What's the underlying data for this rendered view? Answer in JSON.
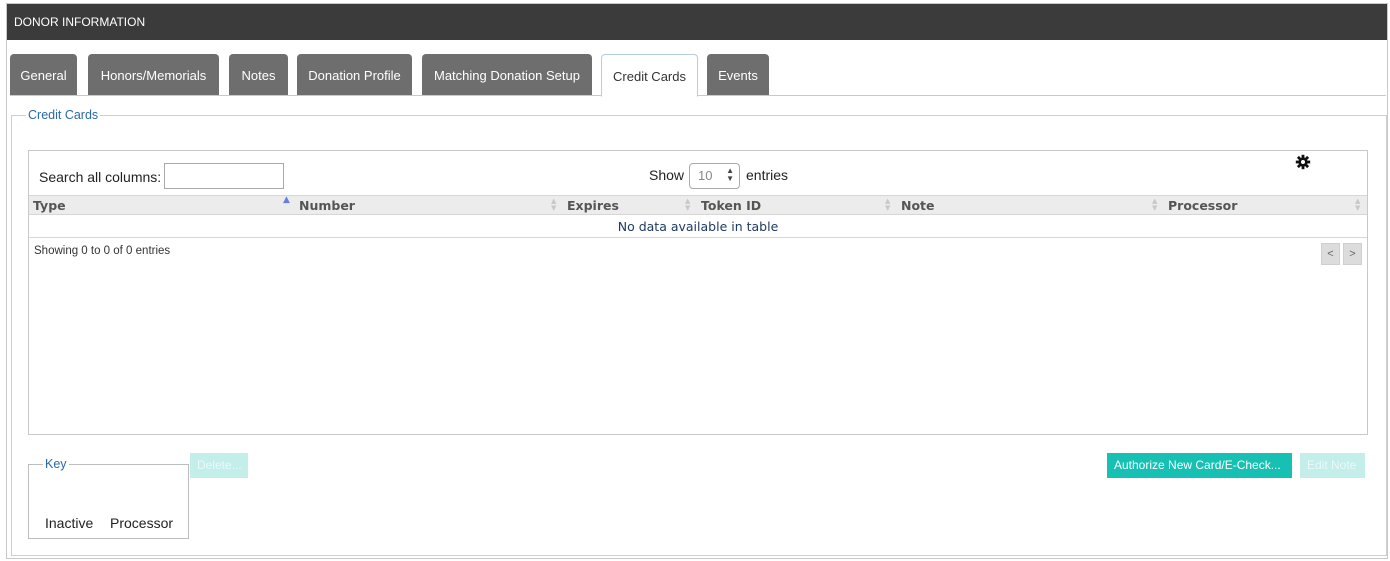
{
  "header": {
    "title": "DONOR INFORMATION"
  },
  "tabs": [
    {
      "label": "General"
    },
    {
      "label": "Honors/Memorials"
    },
    {
      "label": "Notes"
    },
    {
      "label": "Donation Profile"
    },
    {
      "label": "Matching Donation Setup"
    },
    {
      "label": "Credit Cards",
      "active": true
    },
    {
      "label": "Events"
    }
  ],
  "credit_cards": {
    "legend": "Credit Cards",
    "search_label": "Search all columns:",
    "search_value": "",
    "show_label": "Show",
    "show_value": "10",
    "entries_label": "entries",
    "settings_icon": "gear-icon",
    "columns": [
      "Type",
      "Number",
      "Expires",
      "Token ID",
      "Note",
      "Processor"
    ],
    "sorted_column": "Type",
    "empty_message": "No data available in table",
    "info": "Showing 0 to 0 of 0 entries",
    "prev_label": "<",
    "next_label": ">"
  },
  "key": {
    "legend": "Key",
    "items": [
      "Inactive",
      "Processor"
    ]
  },
  "buttons": {
    "delete": "Delete...",
    "authorize": "Authorize New Card/E-Check...",
    "edit_note": "Edit Note"
  },
  "colors": {
    "header_bg": "#3b3b3b",
    "tab_bg": "#6e6e6e",
    "accent": "#16c0b3",
    "legend_text": "#2b6aa8"
  }
}
